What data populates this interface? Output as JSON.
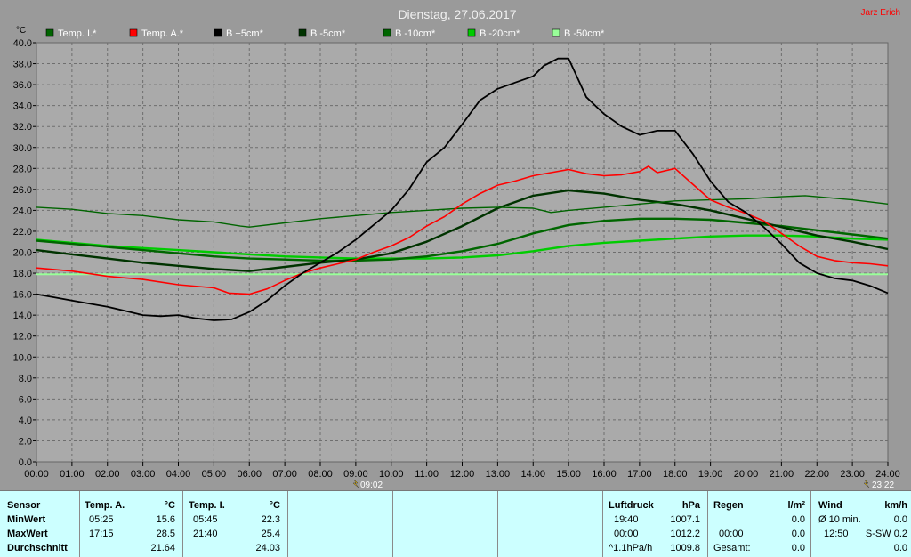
{
  "header": {
    "title": "Dienstag, 27.06.2017",
    "author": "Jarz Erich",
    "unit_label": "°C"
  },
  "colors": {
    "background": "#9a9a9a",
    "plot_area": "#aaaaaa",
    "temp_innen": "#006400",
    "temp_aussen": "#ff0000",
    "b_plus5": "#000000",
    "b_minus5": "#003300",
    "b_minus10": "#006600",
    "b_minus20": "#00cc00",
    "b_minus50": "#99ff99",
    "stats_bg": "#ccffff"
  },
  "markers": {
    "sunrise": "09:02",
    "sunset": "23:22"
  },
  "chart_data": {
    "type": "line",
    "title": "Dienstag, 27.06.2017",
    "ylabel": "°C",
    "ylim": [
      0,
      40
    ],
    "y_tick_step": 2,
    "xlim": [
      0,
      24
    ],
    "x_tick_labels": [
      "00:00",
      "01:00",
      "02:00",
      "03:00",
      "04:00",
      "05:00",
      "06:00",
      "07:00",
      "08:00",
      "09:00",
      "10:00",
      "11:00",
      "12:00",
      "13:00",
      "14:00",
      "15:00",
      "16:00",
      "17:00",
      "18:00",
      "19:00",
      "20:00",
      "21:00",
      "22:00",
      "23:00",
      "24:00"
    ],
    "grid": true,
    "legend_position": "top",
    "series": [
      {
        "name": "Temp. I.*",
        "color": "#006400",
        "width": 1.4,
        "x": [
          0,
          1,
          2,
          3,
          4,
          5,
          5.75,
          6,
          7,
          8,
          9,
          10,
          11,
          12,
          13,
          14,
          14.5,
          15,
          16,
          17,
          18,
          19,
          20,
          21,
          21.67,
          22,
          23,
          24
        ],
        "y": [
          24.3,
          24.1,
          23.7,
          23.5,
          23.1,
          22.9,
          22.5,
          22.4,
          22.8,
          23.2,
          23.5,
          23.8,
          24.0,
          24.2,
          24.3,
          24.2,
          23.8,
          24.0,
          24.3,
          24.6,
          24.9,
          25.0,
          25.1,
          25.3,
          25.4,
          25.3,
          25.0,
          24.6
        ]
      },
      {
        "name": "Temp. A.*",
        "color": "#ff0000",
        "width": 1.6,
        "x": [
          0,
          1,
          2,
          3,
          4,
          5,
          5.42,
          6,
          6.5,
          7,
          7.5,
          8,
          8.5,
          9,
          9.5,
          10,
          10.5,
          11,
          11.5,
          12,
          12.5,
          13,
          13.5,
          14,
          14.5,
          15,
          15.5,
          16,
          16.5,
          17,
          17.25,
          17.5,
          18,
          18.5,
          19,
          19.5,
          20,
          20.5,
          21,
          21.5,
          22,
          22.5,
          23,
          23.5,
          24
        ],
        "y": [
          18.5,
          18.2,
          17.7,
          17.4,
          16.9,
          16.6,
          16.1,
          16.0,
          16.5,
          17.3,
          18.0,
          18.5,
          18.9,
          19.3,
          20.0,
          20.6,
          21.4,
          22.5,
          23.4,
          24.6,
          25.6,
          26.4,
          26.8,
          27.3,
          27.6,
          27.9,
          27.5,
          27.3,
          27.4,
          27.7,
          28.2,
          27.6,
          28.0,
          26.5,
          25.0,
          24.3,
          23.7,
          23.0,
          21.8,
          20.6,
          19.6,
          19.2,
          19.0,
          18.9,
          18.7
        ]
      },
      {
        "name": "B +5cm*",
        "color": "#000000",
        "width": 1.8,
        "x": [
          0,
          0.5,
          1,
          1.5,
          2,
          2.5,
          3,
          3.5,
          4,
          4.5,
          5,
          5.5,
          6,
          6.5,
          7,
          7.5,
          8,
          8.5,
          9,
          9.5,
          10,
          10.5,
          11,
          11.5,
          12,
          12.5,
          13,
          13.5,
          14,
          14.3,
          14.7,
          15,
          15.5,
          16,
          16.5,
          17,
          17.5,
          18,
          18.5,
          19,
          19.5,
          20,
          20.5,
          21,
          21.5,
          22,
          22.5,
          23,
          23.5,
          24
        ],
        "y": [
          16.0,
          15.7,
          15.4,
          15.1,
          14.8,
          14.4,
          14.0,
          13.9,
          14.0,
          13.7,
          13.5,
          13.6,
          14.3,
          15.4,
          16.8,
          18.0,
          19.0,
          20.0,
          21.2,
          22.6,
          24.0,
          26.0,
          28.6,
          30.0,
          32.2,
          34.5,
          35.6,
          36.2,
          36.8,
          37.8,
          38.5,
          38.5,
          34.8,
          33.2,
          32.0,
          31.2,
          31.6,
          31.6,
          29.4,
          26.8,
          24.8,
          23.8,
          22.4,
          20.8,
          19.0,
          18.0,
          17.5,
          17.3,
          16.8,
          16.1
        ]
      },
      {
        "name": "B -5cm*",
        "color": "#003300",
        "width": 2.4,
        "x": [
          0,
          1,
          2,
          3,
          4,
          5,
          6,
          7,
          8,
          9,
          10,
          11,
          12,
          13,
          14,
          15,
          16,
          17,
          18,
          19,
          20,
          21,
          22,
          23,
          24
        ],
        "y": [
          20.2,
          19.8,
          19.4,
          19.0,
          18.7,
          18.4,
          18.2,
          18.6,
          19.0,
          19.3,
          19.9,
          21.0,
          22.5,
          24.2,
          25.4,
          25.9,
          25.6,
          25.0,
          24.6,
          24.0,
          23.2,
          22.4,
          21.6,
          21.0,
          20.3
        ]
      },
      {
        "name": "B -10cm*",
        "color": "#006600",
        "width": 2.4,
        "x": [
          0,
          1,
          2,
          3,
          4,
          5,
          6,
          7,
          8,
          9,
          10,
          11,
          12,
          13,
          14,
          15,
          16,
          17,
          18,
          19,
          20,
          21,
          22,
          23,
          24
        ],
        "y": [
          21.1,
          20.8,
          20.5,
          20.2,
          19.9,
          19.6,
          19.4,
          19.3,
          19.2,
          19.2,
          19.3,
          19.6,
          20.1,
          20.8,
          21.8,
          22.6,
          23.0,
          23.2,
          23.2,
          23.1,
          22.8,
          22.5,
          22.1,
          21.7,
          21.3
        ]
      },
      {
        "name": "B -20cm*",
        "color": "#00cc00",
        "width": 2.4,
        "x": [
          0,
          1,
          2,
          3,
          4,
          5,
          6,
          7,
          8,
          9,
          10,
          11,
          12,
          13,
          14,
          15,
          16,
          17,
          18,
          19,
          20,
          21,
          22,
          23,
          24
        ],
        "y": [
          21.2,
          20.9,
          20.6,
          20.4,
          20.2,
          20.0,
          19.8,
          19.6,
          19.5,
          19.4,
          19.4,
          19.4,
          19.5,
          19.7,
          20.1,
          20.6,
          20.9,
          21.1,
          21.3,
          21.5,
          21.6,
          21.6,
          21.5,
          21.3,
          21.2
        ]
      },
      {
        "name": "B -50cm*",
        "color": "#99ff99",
        "width": 2,
        "x": [
          0,
          4,
          8,
          12,
          16,
          20,
          24
        ],
        "y": [
          17.9,
          17.9,
          17.9,
          17.9,
          17.9,
          17.9,
          17.9
        ]
      }
    ]
  },
  "stats": {
    "sensor_col": {
      "header": "Sensor",
      "rows": [
        "MinWert",
        "MaxWert",
        "Durchschnitt"
      ]
    },
    "temp_a": {
      "header": "Temp. A.",
      "unit": "°C",
      "min_time": "05:25",
      "min_val": "15.6",
      "max_time": "17:15",
      "max_val": "28.5",
      "avg": "21.64"
    },
    "temp_i": {
      "header": "Temp. I.",
      "unit": "°C",
      "min_time": "05:45",
      "min_val": "22.3",
      "max_time": "21:40",
      "max_val": "25.4",
      "avg": "24.03"
    },
    "luftdruck": {
      "header": "Luftdruck",
      "unit": "hPa",
      "min_time": "19:40",
      "min_val": "1007.1",
      "max_time": "00:00",
      "max_val": "1012.2",
      "trend": "^1.1hPa/h",
      "trend_val": "1009.8"
    },
    "regen": {
      "header": "Regen",
      "unit": "l/m²",
      "r1": "",
      "r1_val": "0.0",
      "r2_time": "00:00",
      "r2_val": "0.0",
      "r3": "Gesamt:",
      "r3_val": "0.0"
    },
    "wind": {
      "header": "Wind",
      "unit": "km/h",
      "r1": "Ø 10 min.",
      "r1_val": "0.0",
      "r2_time": "12:50",
      "r2_val": "S-SW 0.2",
      "r3": "",
      "r3_val": "0.0"
    }
  }
}
